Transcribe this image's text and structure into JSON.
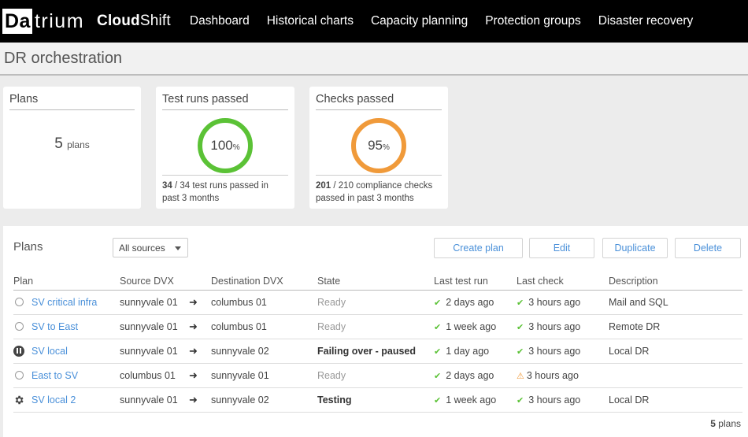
{
  "brand": {
    "logo_box": "Da",
    "logo_rest": "trium",
    "product_bold": "Cloud",
    "product_rest": "Shift"
  },
  "nav": [
    "Dashboard",
    "Historical charts",
    "Capacity planning",
    "Protection groups",
    "Disaster recovery"
  ],
  "page_title": "DR orchestration",
  "cards": {
    "plans": {
      "title": "Plans",
      "count": "5",
      "unit": "plans"
    },
    "test_runs": {
      "title": "Test runs passed",
      "percent": "100",
      "percent_sign": "%",
      "passed": "34",
      "footer_rest": " / 34 test runs passed in",
      "footer_line2": "past  3 months"
    },
    "checks": {
      "title": "Checks passed",
      "percent": "95",
      "percent_sign": "%",
      "passed": "201",
      "footer_rest": " / 210 compliance checks",
      "footer_line2": "passed in past  3 months"
    }
  },
  "colors": {
    "green": "#5bc236",
    "orange": "#f09a3a",
    "link": "#4a90d9"
  },
  "panel": {
    "title": "Plans",
    "source_filter": "All sources",
    "buttons": {
      "create": "Create plan",
      "edit": "Edit",
      "duplicate": "Duplicate",
      "delete": "Delete"
    },
    "columns": [
      "Plan",
      "Source DVX",
      "Destination DVX",
      "State",
      "Last test run",
      "Last check",
      "Description"
    ],
    "rows": [
      {
        "icon": "circle-icon",
        "plan": "SV critical infra",
        "source": "sunnyvale 01",
        "dest": "columbus 01",
        "state": "Ready",
        "state_style": "ready",
        "last_test": "2 days ago",
        "test_icon": "check-icon",
        "last_check": "3 hours ago",
        "check_icon": "check-icon",
        "description": "Mail and SQL"
      },
      {
        "icon": "circle-icon",
        "plan": "SV to East",
        "source": "sunnyvale 01",
        "dest": "columbus 01",
        "state": "Ready",
        "state_style": "ready",
        "last_test": "1 week ago",
        "test_icon": "check-icon",
        "last_check": "3 hours ago",
        "check_icon": "check-icon",
        "description": "Remote DR"
      },
      {
        "icon": "pause-icon",
        "plan": "SV local",
        "source": "sunnyvale 01",
        "dest": "sunnyvale 02",
        "state": "Failing over - paused",
        "state_style": "bold",
        "last_test": "1 day ago",
        "test_icon": "check-icon",
        "last_check": "3 hours ago",
        "check_icon": "check-icon",
        "description": "Local DR"
      },
      {
        "icon": "circle-icon",
        "plan": "East to SV",
        "source": "columbus 01",
        "dest": "sunnyvale 01",
        "state": "Ready",
        "state_style": "ready",
        "last_test": "2 days ago",
        "test_icon": "check-icon",
        "last_check": "3 hours ago",
        "check_icon": "warning-icon",
        "description": ""
      },
      {
        "icon": "gear-icon",
        "plan": "SV local 2",
        "source": "sunnyvale 01",
        "dest": "sunnyvale 02",
        "state": "Testing",
        "state_style": "bold",
        "last_test": "1 week ago",
        "test_icon": "check-icon",
        "last_check": "3 hours ago",
        "check_icon": "check-icon",
        "description": "Local DR"
      }
    ],
    "footer_count": "5",
    "footer_unit": " plans"
  }
}
